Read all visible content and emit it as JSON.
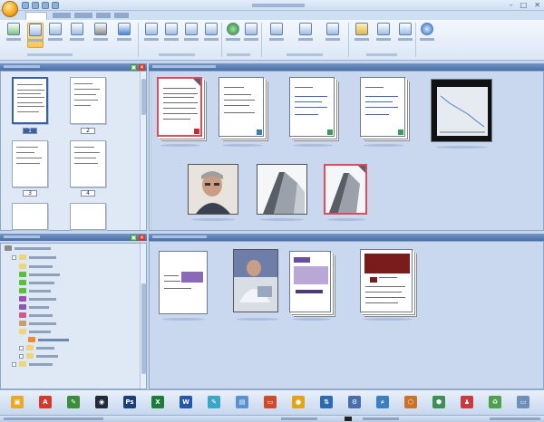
{
  "window": {
    "close_glyph": "✕",
    "minimize_glyph": "–",
    "maximize_glyph": "□"
  },
  "pages": [
    {
      "number": "1",
      "selected": true
    },
    {
      "number": "2",
      "selected": false
    },
    {
      "number": "3",
      "selected": false
    },
    {
      "number": "4",
      "selected": false
    }
  ],
  "pane": {
    "restore_glyph": "▣",
    "close_glyph": "✕"
  },
  "taskbar_apps": [
    {
      "name": "folder-app-icon",
      "color": "#e8a92a",
      "glyph": "▣"
    },
    {
      "name": "pdf-app-icon",
      "color": "#d33a2c",
      "glyph": "A"
    },
    {
      "name": "paint-app-icon",
      "color": "#3c8c3c",
      "glyph": "✎"
    },
    {
      "name": "camera-app-icon",
      "color": "#222a3a",
      "glyph": "◉"
    },
    {
      "name": "photoshop-app-icon",
      "color": "#1c3f7a",
      "glyph": "Ps"
    },
    {
      "name": "excel-app-icon",
      "color": "#1f7b3a",
      "glyph": "X"
    },
    {
      "name": "word-app-icon",
      "color": "#2457a6",
      "glyph": "W"
    },
    {
      "name": "edit-app-icon",
      "color": "#3aa7c8",
      "glyph": "✎"
    },
    {
      "name": "document-app-icon",
      "color": "#5b8fd1",
      "glyph": "▤"
    },
    {
      "name": "presentation-app-icon",
      "color": "#cf4a2a",
      "glyph": "▭"
    },
    {
      "name": "globe-app-icon",
      "color": "#e3a41a",
      "glyph": "●"
    },
    {
      "name": "ftp-app-icon",
      "color": "#2d6bb0",
      "glyph": "⇅"
    },
    {
      "name": "network-app-icon",
      "color": "#4a6fa8",
      "glyph": "⚙"
    },
    {
      "name": "search-app-icon",
      "color": "#3b7fc1",
      "glyph": "⌕"
    },
    {
      "name": "stamp-app-icon",
      "color": "#c9722a",
      "glyph": "⬡"
    },
    {
      "name": "share-app-icon",
      "color": "#3f8e57",
      "glyph": "⬢"
    },
    {
      "name": "users-app-icon",
      "color": "#c63b3b",
      "glyph": "♟"
    },
    {
      "name": "recycle-app-icon",
      "color": "#4ea04e",
      "glyph": "♻"
    },
    {
      "name": "scan-app-icon",
      "color": "#6d8fb8",
      "glyph": "▭"
    }
  ],
  "images": {
    "portrait_alt": "Man in glasses portrait",
    "building_alt": "Building photo"
  },
  "colors": {
    "accent": "#4a6ea6",
    "selection": "#e04a5a",
    "ribbon_highlight": "#f7c659"
  }
}
